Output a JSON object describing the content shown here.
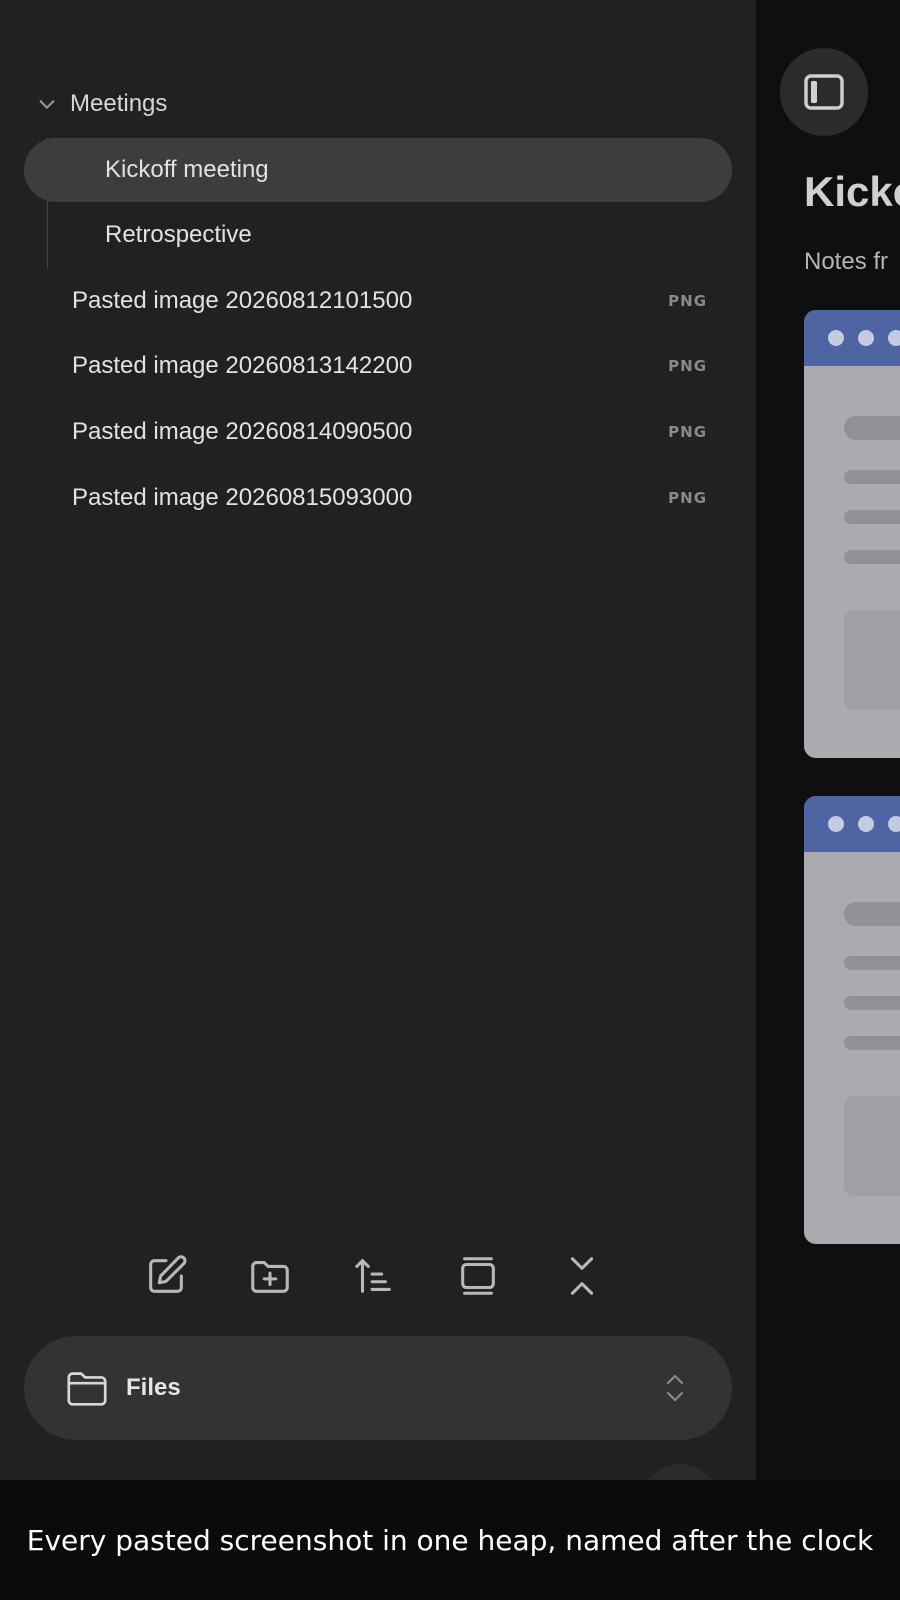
{
  "sidebar": {
    "folder": {
      "name": "Meetings",
      "expanded": true
    },
    "children": [
      {
        "label": "Kickoff meeting",
        "active": true
      },
      {
        "label": "Retrospective",
        "active": false
      }
    ],
    "files": [
      {
        "label": "Pasted image 20260812101500",
        "ext": "PNG"
      },
      {
        "label": "Pasted image 20260813142200",
        "ext": "PNG"
      },
      {
        "label": "Pasted image 20260814090500",
        "ext": "PNG"
      },
      {
        "label": "Pasted image 20260815093000",
        "ext": "PNG"
      }
    ],
    "toolbar": [
      "new-note-icon",
      "new-folder-icon",
      "sort-icon",
      "auto-reveal-icon",
      "collapse-all-icon"
    ],
    "switcher": {
      "label": "Files",
      "icon": "folder-icon"
    }
  },
  "main": {
    "title": "Kicko",
    "subtitle": "Notes fr"
  },
  "banner": {
    "text": "Every pasted screenshot in one heap, named after the clock"
  },
  "colors": {
    "sidebar_bg": "#212121",
    "active_item_bg": "#3d3d3d",
    "main_bg": "#0f0f0f",
    "screenshot_header": "#4e64a3"
  }
}
